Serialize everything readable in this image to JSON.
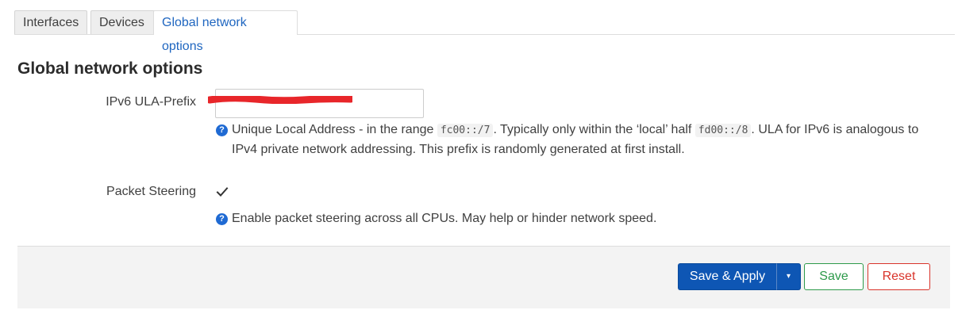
{
  "tabs": [
    {
      "label": "Interfaces",
      "active": false
    },
    {
      "label": "Devices",
      "active": false
    },
    {
      "label": "Global network options",
      "active": true
    }
  ],
  "section": {
    "title": "Global network options"
  },
  "ula_prefix": {
    "label": "IPv6 ULA-Prefix",
    "value": "",
    "redacted": true,
    "help": {
      "part1": "Unique Local Address - in the range ",
      "code1": "fc00::/7",
      "part2": ". Typically only within the ‘local’ half ",
      "code2": "fd00::/8",
      "part3": ". ULA for IPv6 is analogous to",
      "line2": "IPv4 private network addressing. This prefix is randomly generated at first install."
    }
  },
  "packet_steering": {
    "label": "Packet Steering",
    "checked": true,
    "help": "Enable packet steering across all CPUs. May help or hinder network speed."
  },
  "footer": {
    "save_apply_label": "Save & Apply",
    "dropdown_label": "▾",
    "save_label": "Save",
    "reset_label": "Reset"
  },
  "colors": {
    "primary": "#0e56b4",
    "save": "#2d9a4a",
    "reset": "#d9342b",
    "active_tab": "#1f66c0",
    "help_icon": "#1f6ad3",
    "redaction": "#e8262a"
  },
  "icons": {
    "help": "question-circle-icon",
    "checkbox": "checkmark-icon",
    "dropdown": "caret-down-icon"
  }
}
